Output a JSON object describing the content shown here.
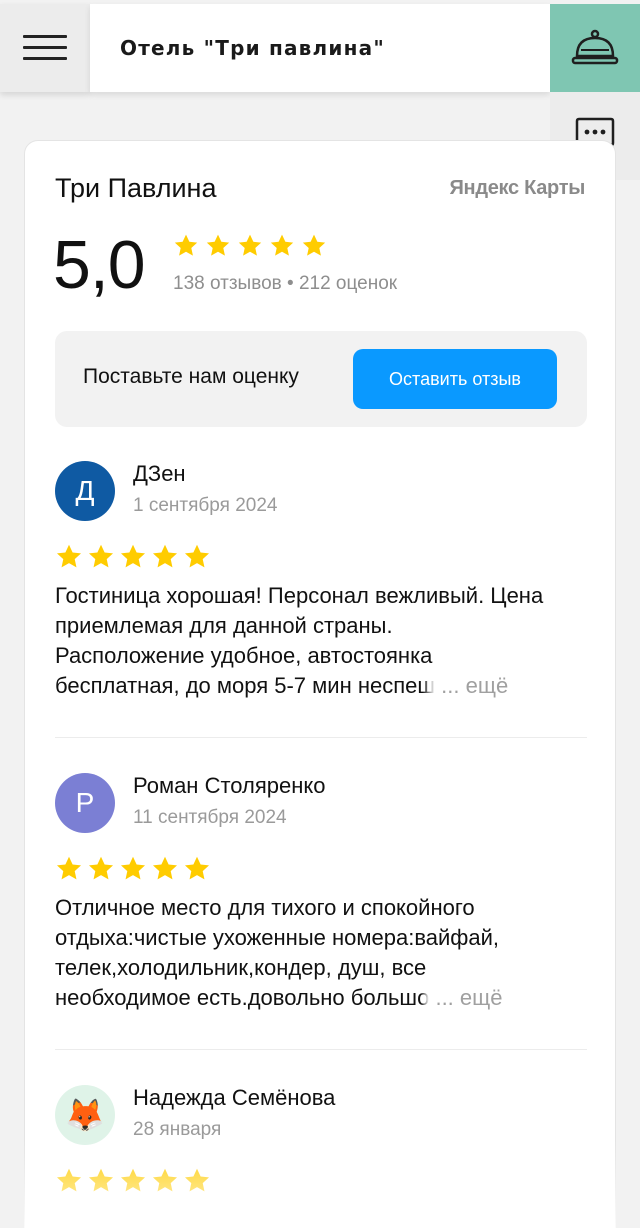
{
  "header": {
    "title": "Отель \"Три павлина\"",
    "menu_icon": "hamburger-menu-icon",
    "reception_icon": "reception-bell-icon",
    "chat_icon": "chat-bubble-icon",
    "accent_color": "#7fc6b2"
  },
  "widget": {
    "org_name": "Три Павлина",
    "source": "Яндекс Карты",
    "rating": "5,0",
    "stars": 5,
    "counts": "138 отзывов • 212 оценок",
    "cta_text": "Поставьте нам оценку",
    "cta_button": "Оставить отзыв",
    "star_color": "#ffcc00",
    "button_color": "#0a99ff"
  },
  "reviews": [
    {
      "avatar_letter": "Д",
      "avatar_color": "#0f5aa3",
      "author": "ДЗен",
      "date": "1 сентября 2024",
      "stars": 5,
      "lines": [
        "Гостиница хорошая! Персонал вежливый. Цена",
        "приемлемая для данной страны.",
        "Расположение удобное, автостоянка"
      ],
      "last_line": "бесплатная, до моря 5-7 мин неспе",
      "fade_tail": "ш",
      "more": "... ещё"
    },
    {
      "avatar_letter": "Р",
      "avatar_color": "#7b7fd4",
      "author": "Роман Столяренко",
      "date": "11 сентября 2024",
      "stars": 5,
      "lines": [
        "Отличное место для тихого и спокойного",
        "отдыха:чистые ухоженные номера:вайфай,",
        "телек,холодильник,кондер, душ, все"
      ],
      "last_line": "необходимое есть.довольно больш",
      "fade_tail": "о",
      "more": "... ещё"
    },
    {
      "avatar_icon": "fox-emoji-icon",
      "avatar_glyph": "🦊",
      "avatar_color": "#dff3e8",
      "author": "Надежда Семёнова",
      "date": "28 января",
      "stars": 5
    }
  ]
}
